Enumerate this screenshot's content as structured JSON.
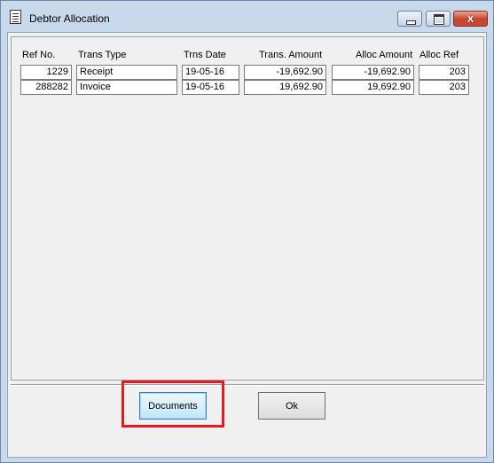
{
  "window": {
    "title": "Debtor Allocation",
    "close_glyph": "x",
    "icon": "document-icon"
  },
  "table": {
    "headers": [
      "Ref No.",
      "Trans Type",
      "Trns Date",
      "Trans. Amount",
      "Alloc Amount",
      "Alloc Ref"
    ],
    "rows": [
      [
        "1229",
        "Receipt",
        "19-05-16",
        "-19,692.90",
        "-19,692.90",
        "203"
      ],
      [
        "288282",
        "Invoice",
        "19-05-16",
        "19,692.90",
        "19,692.90",
        "203"
      ]
    ]
  },
  "buttons": {
    "documents": "Documents",
    "ok": "Ok"
  },
  "colors": {
    "highlight": "#e21c23",
    "title_bar": "#c9d9ec",
    "close_button": "#c7432b"
  }
}
